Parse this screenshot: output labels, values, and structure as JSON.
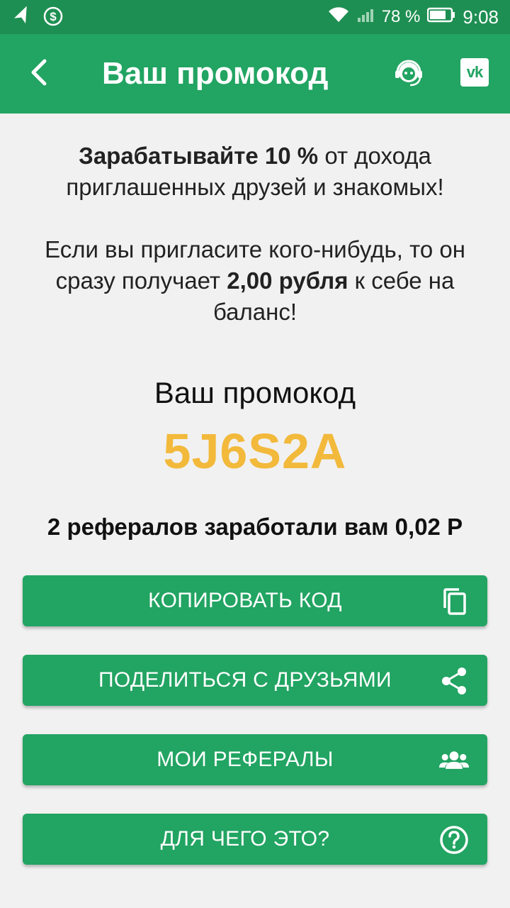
{
  "status_bar": {
    "battery": "78 %",
    "time": "9:08",
    "icons": [
      "navigation-icon",
      "dollar-icon",
      "wifi-icon",
      "signal-icon",
      "battery-icon"
    ]
  },
  "app_bar": {
    "title": "Ваш промокод",
    "icons": [
      "back-arrow-icon",
      "support-agent-icon",
      "vk-icon"
    ],
    "vk_label": "vk"
  },
  "intro": {
    "line1_bold": "Зарабатывайте 10 %",
    "line1_rest": " от дохода приглашенных друзей и знакомых!",
    "line2_start": "Если вы пригласите кого-нибудь, то он сразу получает ",
    "line2_bold": "2,00 рубля",
    "line2_end": " к себе на баланс!"
  },
  "promo": {
    "label": "Ваш промокод",
    "code": "5J6S2A",
    "code_color": "#f2b93b"
  },
  "referral_stat": "2 рефералов заработали вам 0,02 Р",
  "buttons": [
    {
      "label": "КОПИРОВАТЬ КОД",
      "icon": "copy-icon"
    },
    {
      "label": "ПОДЕЛИТЬСЯ С ДРУЗЬЯМИ",
      "icon": "share-icon"
    },
    {
      "label": "МОИ РЕФЕРАЛЫ",
      "icon": "group-icon"
    },
    {
      "label": "ДЛЯ ЧЕГО ЭТО?",
      "icon": "help-icon"
    }
  ],
  "colors": {
    "status_bar": "#1e8f52",
    "primary": "#22a462",
    "accent": "#f2b93b",
    "background": "#f1f1f1"
  }
}
